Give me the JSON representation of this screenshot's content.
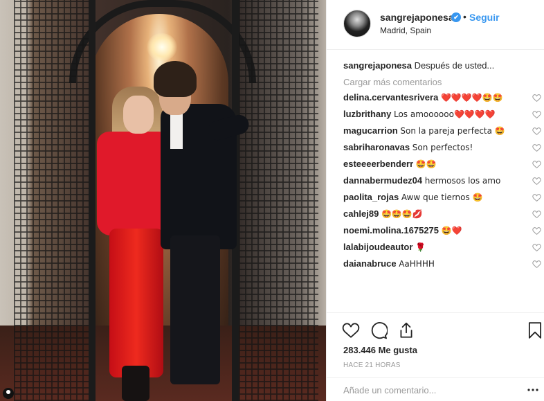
{
  "header": {
    "username": "sangrejaponesa",
    "verified_mark": "✔",
    "separator": "•",
    "follow_label": "Seguir",
    "location": "Madrid, Spain"
  },
  "caption": {
    "username": "sangrejaponesa",
    "text": "Después de usted..."
  },
  "load_more_label": "Cargar más comentarios",
  "comments": [
    {
      "user": "delina.cervantesrivera",
      "text": "❤️❤️❤️❤️🤩🤩"
    },
    {
      "user": "luzbrithany",
      "text": "Los amoooooo❤️❤️❤️❤️"
    },
    {
      "user": "magucarrion",
      "text": "Son la pareja perfecta 🤩"
    },
    {
      "user": "sabriharonavas",
      "text": "Son perfectos!"
    },
    {
      "user": "esteeeerbenderr",
      "text": "🤩🤩"
    },
    {
      "user": "dannabermudez04",
      "text": "hermosos los amo"
    },
    {
      "user": "paolita_rojas",
      "text": "Aww que tiernos 🤩"
    },
    {
      "user": "cahlej89",
      "text": "🤩🤩🤩💋"
    },
    {
      "user": "noemi.molina.1675275",
      "text": "🤩❤️"
    },
    {
      "user": "lalabijoudeautor",
      "text": "🌹"
    },
    {
      "user": "daianabruce",
      "text": "AaHHHH"
    }
  ],
  "likes": "283.446 Me gusta",
  "timestamp": "HACE 21 HORAS",
  "comment_input": {
    "placeholder": "Añade un comentario..."
  },
  "icons": [
    "heart-icon",
    "comment-icon",
    "share-icon",
    "bookmark-icon",
    "more-icon"
  ],
  "colors": {
    "accent": "#3897f0",
    "heart": "#ed4956",
    "muted": "#999999",
    "text": "#262626"
  }
}
